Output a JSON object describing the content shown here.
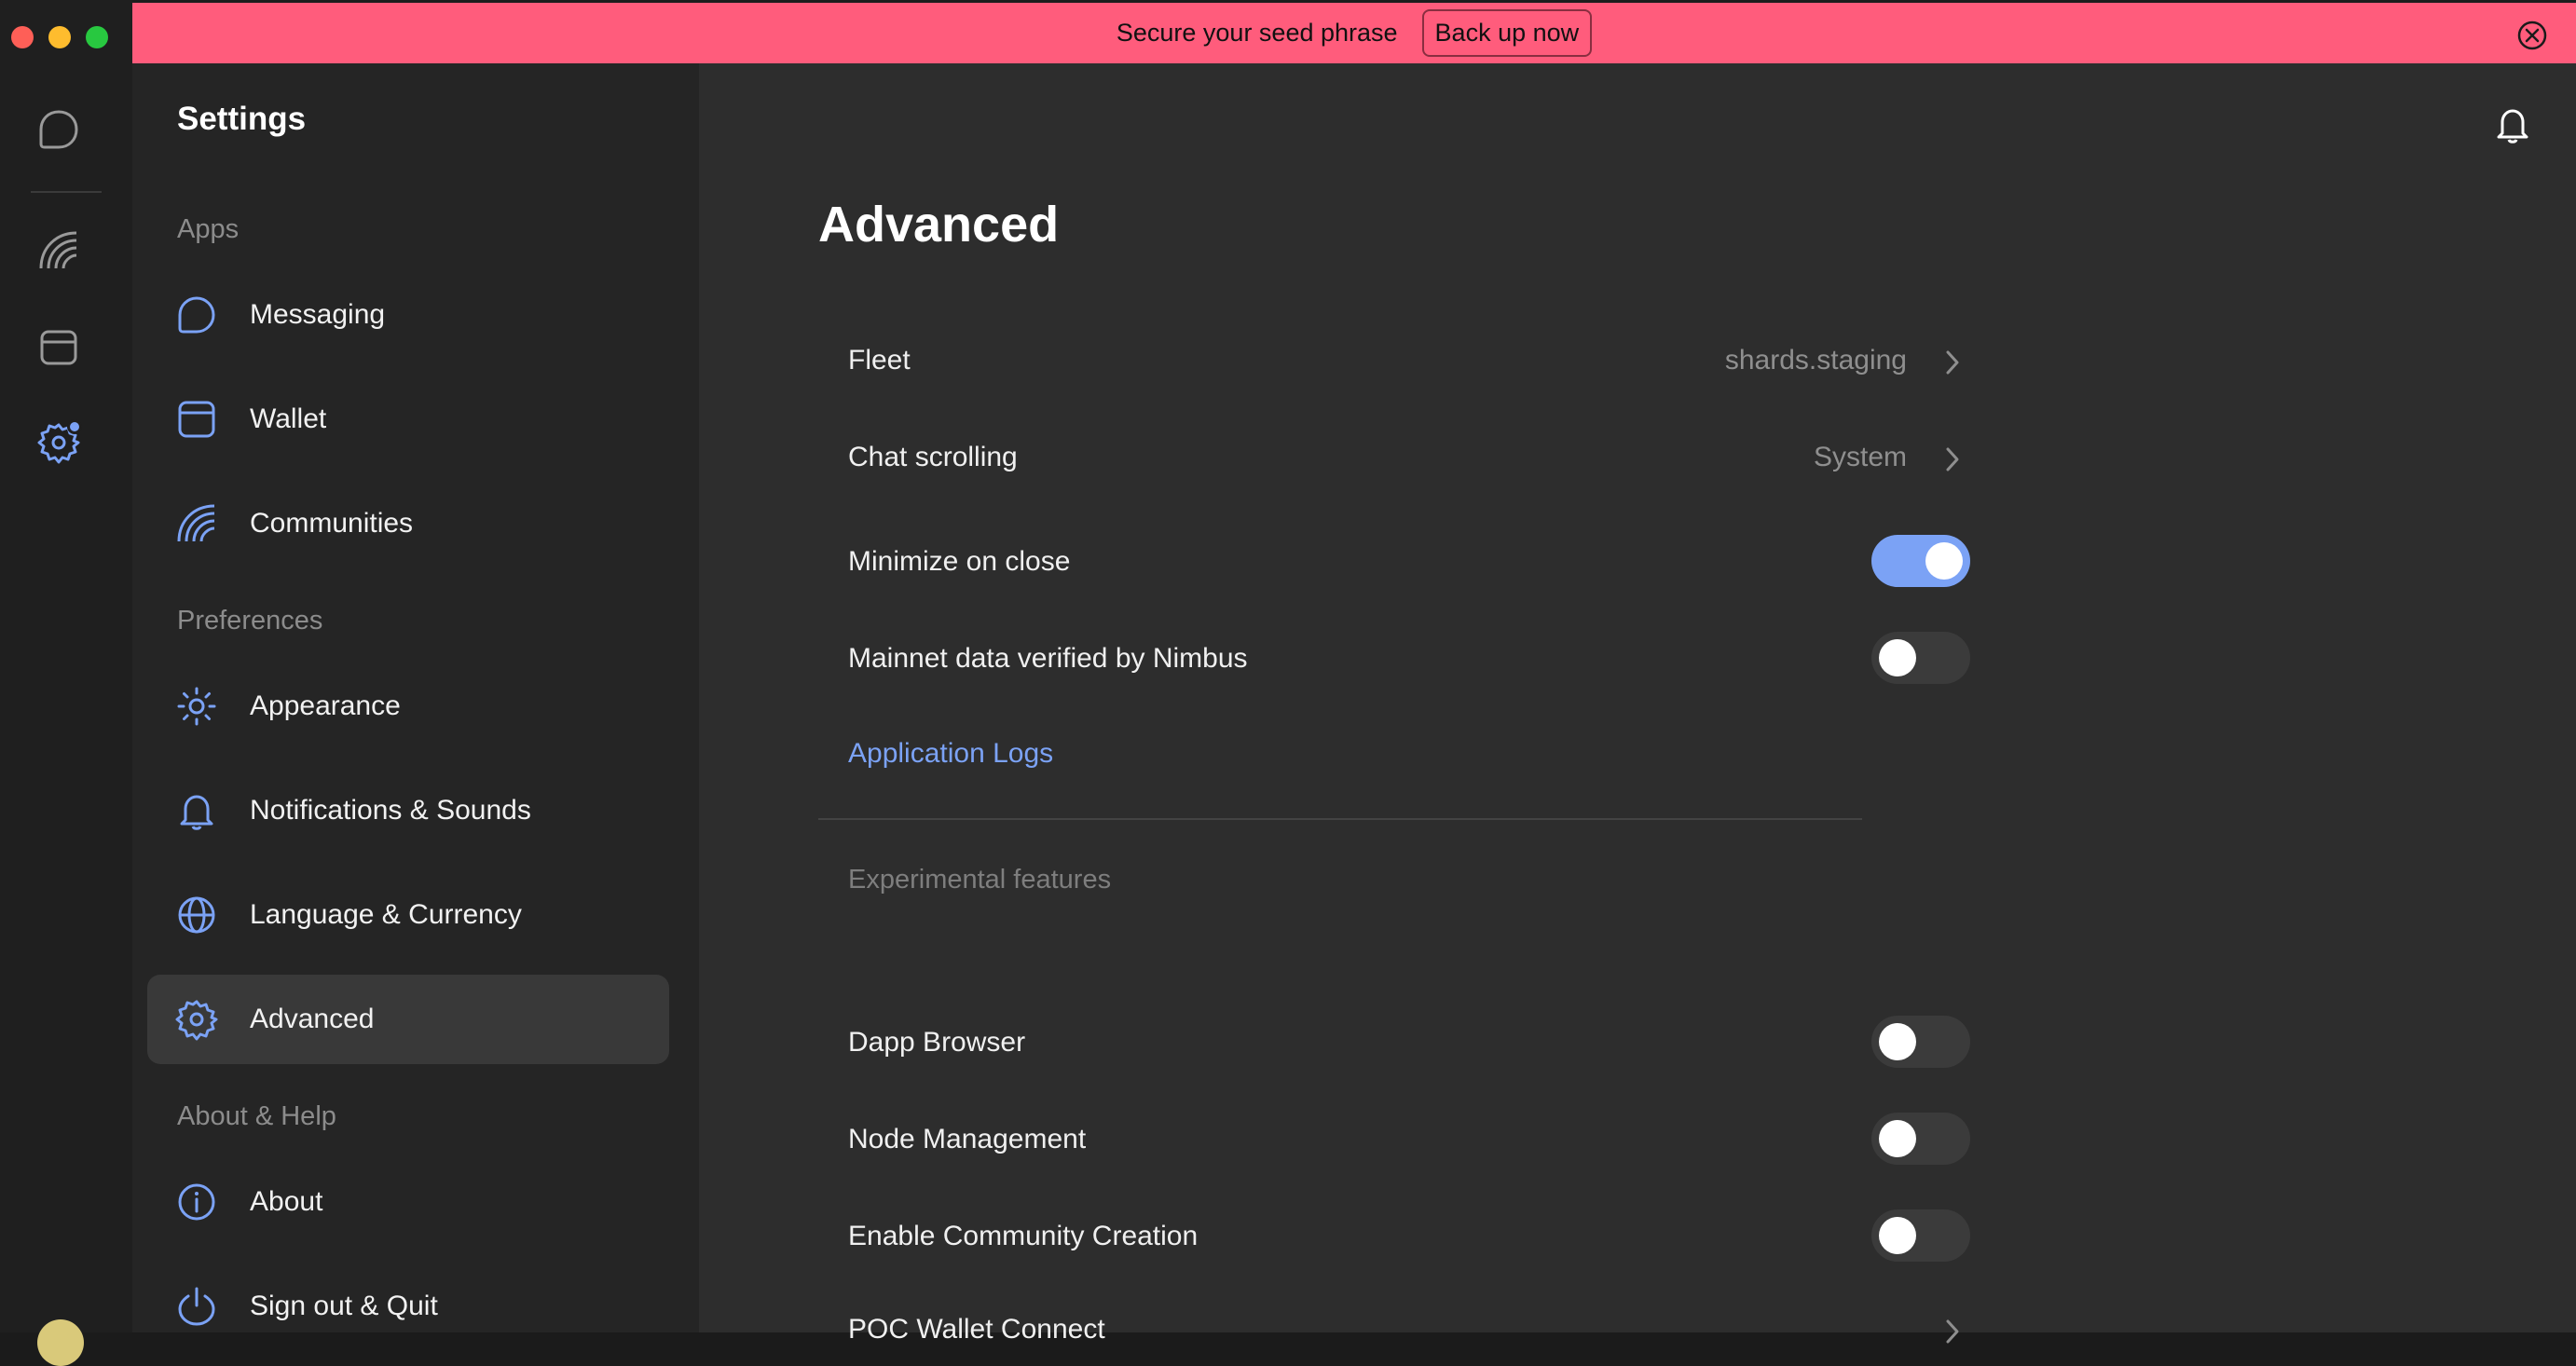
{
  "banner": {
    "text": "Secure your seed phrase",
    "button_label": "Back up now",
    "background": "#ff5c7c"
  },
  "rail": {
    "icons": [
      "chat-icon",
      "communities-icon",
      "wallet-icon",
      "settings-icon"
    ],
    "settings_has_badge": true
  },
  "sidebar": {
    "title": "Settings",
    "sections": [
      {
        "label": "Apps",
        "items": [
          {
            "label": "Messaging",
            "icon": "chat-icon"
          },
          {
            "label": "Wallet",
            "icon": "wallet-icon"
          },
          {
            "label": "Communities",
            "icon": "communities-icon"
          }
        ]
      },
      {
        "label": "Preferences",
        "items": [
          {
            "label": "Appearance",
            "icon": "sun-icon"
          },
          {
            "label": "Notifications & Sounds",
            "icon": "bell-icon"
          },
          {
            "label": "Language & Currency",
            "icon": "globe-icon"
          },
          {
            "label": "Advanced",
            "icon": "gear-icon",
            "active": true
          }
        ]
      },
      {
        "label": "About & Help",
        "items": [
          {
            "label": "About",
            "icon": "info-icon"
          },
          {
            "label": "Sign out & Quit",
            "icon": "power-icon"
          }
        ]
      }
    ]
  },
  "main": {
    "title": "Advanced",
    "settings": [
      {
        "label": "Fleet",
        "value": "shards.staging",
        "type": "nav"
      },
      {
        "label": "Chat scrolling",
        "value": "System",
        "type": "nav"
      },
      {
        "label": "Minimize on close",
        "type": "toggle",
        "on": true
      },
      {
        "label": "Mainnet data verified by Nimbus",
        "type": "toggle",
        "on": false
      }
    ],
    "logs_link": "Application Logs",
    "experimental_label": "Experimental features",
    "experimental": [
      {
        "label": "Dapp Browser",
        "type": "toggle",
        "on": false
      },
      {
        "label": "Node Management",
        "type": "toggle",
        "on": false
      },
      {
        "label": "Enable Community Creation",
        "type": "toggle",
        "on": false
      },
      {
        "label": "POC Wallet Connect",
        "type": "nav"
      }
    ]
  },
  "colors": {
    "accent": "#7ba2f5",
    "sidebar_bg": "#252525",
    "main_bg": "#2d2d2d"
  }
}
